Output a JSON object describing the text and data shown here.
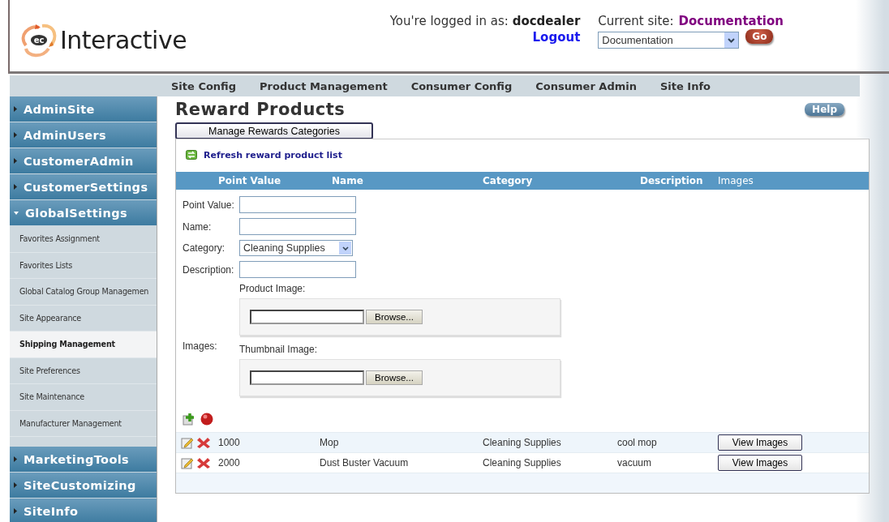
{
  "logo": {
    "mark": "ec",
    "text": "Interactive"
  },
  "user": {
    "label": "You're logged in as:",
    "name": "docdealer",
    "logout": "Logout"
  },
  "site": {
    "label": "Current site:",
    "name": "Documentation",
    "select_value": "Documentation",
    "go": "Go"
  },
  "nav": [
    "Site Config",
    "Product Management",
    "Consumer Config",
    "Consumer Admin",
    "Site Info"
  ],
  "sidebar": [
    {
      "label": "AdminSite",
      "expanded": false
    },
    {
      "label": "AdminUsers",
      "expanded": false
    },
    {
      "label": "CustomerAdmin",
      "expanded": false
    },
    {
      "label": "CustomerSettings",
      "expanded": false
    },
    {
      "label": "GlobalSettings",
      "expanded": true,
      "children": [
        {
          "label": "Favorites Assignment",
          "selected": false
        },
        {
          "label": "Favorites Lists",
          "selected": false
        },
        {
          "label": "Global Catalog Group Managemen",
          "selected": false
        },
        {
          "label": "Site Appearance",
          "selected": false
        },
        {
          "label": "Shipping Management",
          "selected": true
        },
        {
          "label": "Site Preferences",
          "selected": false
        },
        {
          "label": "Site Maintenance",
          "selected": false
        },
        {
          "label": "Manufacturer Management",
          "selected": false
        }
      ]
    },
    {
      "label": "MarketingTools",
      "expanded": false
    },
    {
      "label": "SiteCustomizing",
      "expanded": false
    },
    {
      "label": "SiteInfo",
      "expanded": false
    }
  ],
  "page": {
    "title": "Reward Products",
    "help": "Help",
    "manage_button": "Manage Rewards Categories",
    "refresh_link": "Refresh reward product list"
  },
  "table": {
    "columns": [
      {
        "label": "Point Value",
        "bold": true
      },
      {
        "label": "Name",
        "bold": true
      },
      {
        "label": "Category",
        "bold": true
      },
      {
        "label": "Description",
        "bold": true
      },
      {
        "label": "Images",
        "bold": false
      }
    ],
    "form": {
      "point_label": "Point Value:",
      "name_label": "Name:",
      "category_label": "Category:",
      "category_value": "Cleaning Supplies",
      "description_label": "Description:",
      "images_label": "Images:",
      "uploads": [
        {
          "label": "Product Image:",
          "browse": "Browse..."
        },
        {
          "label": "Thumbnail Image:",
          "browse": "Browse..."
        }
      ]
    },
    "rows": [
      {
        "point_value": "1000",
        "name": "Mop",
        "category": "Cleaning Supplies",
        "description": "cool mop",
        "action": "View Images"
      },
      {
        "point_value": "2000",
        "name": "Dust Buster Vacuum",
        "category": "Cleaning Supplies",
        "description": "vacuum",
        "action": "View Images"
      }
    ]
  }
}
